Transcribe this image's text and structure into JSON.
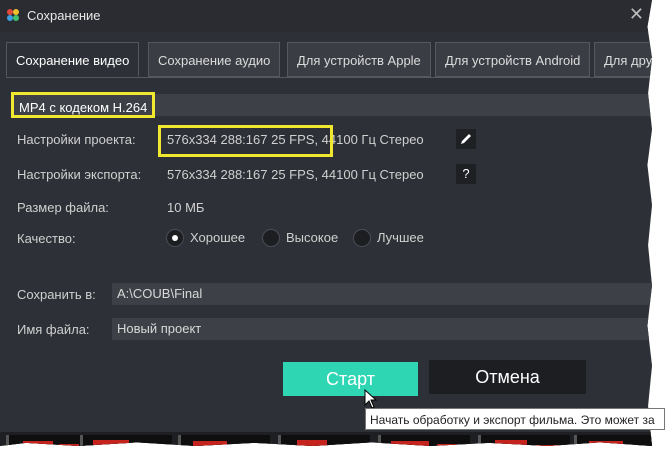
{
  "window": {
    "title": "Сохранение"
  },
  "tabs": [
    {
      "label": "Сохранение видео",
      "active": true
    },
    {
      "label": "Сохранение аудио",
      "active": false
    },
    {
      "label": "Для устройств Apple",
      "active": false
    },
    {
      "label": "Для устройств Android",
      "active": false
    },
    {
      "label": "Для дру",
      "active": false
    }
  ],
  "format": {
    "label": "MP4 с кодеком H.264"
  },
  "project_settings": {
    "label": "Настройки проекта:",
    "value": "576x334 288:167 25 FPS, 44100 Гц Стерео",
    "edit_icon": "pencil-icon"
  },
  "export_settings": {
    "label": "Настройки экспорта:",
    "value": "576x334 288:167 25 FPS, 44100 Гц Стерео",
    "help_icon": "question-icon",
    "help_glyph": "?"
  },
  "file_size": {
    "label": "Размер файла:",
    "value": "10 МБ"
  },
  "quality": {
    "label": "Качество:",
    "options": [
      {
        "label": "Хорошее",
        "selected": true
      },
      {
        "label": "Высокое",
        "selected": false
      },
      {
        "label": "Лучшее",
        "selected": false
      }
    ]
  },
  "save_to": {
    "label": "Сохранить в:",
    "value": "A:\\COUB\\Final"
  },
  "file_name": {
    "label": "Имя файла:",
    "value": "Новый проект"
  },
  "buttons": {
    "start": "Старт",
    "cancel": "Отмена"
  },
  "tooltip": {
    "text": "Начать обработку и экспорт фильма. Это может за"
  },
  "colors": {
    "accent": "#2fd6b4",
    "highlight": "#f0e72f",
    "background": "#2d3036"
  }
}
